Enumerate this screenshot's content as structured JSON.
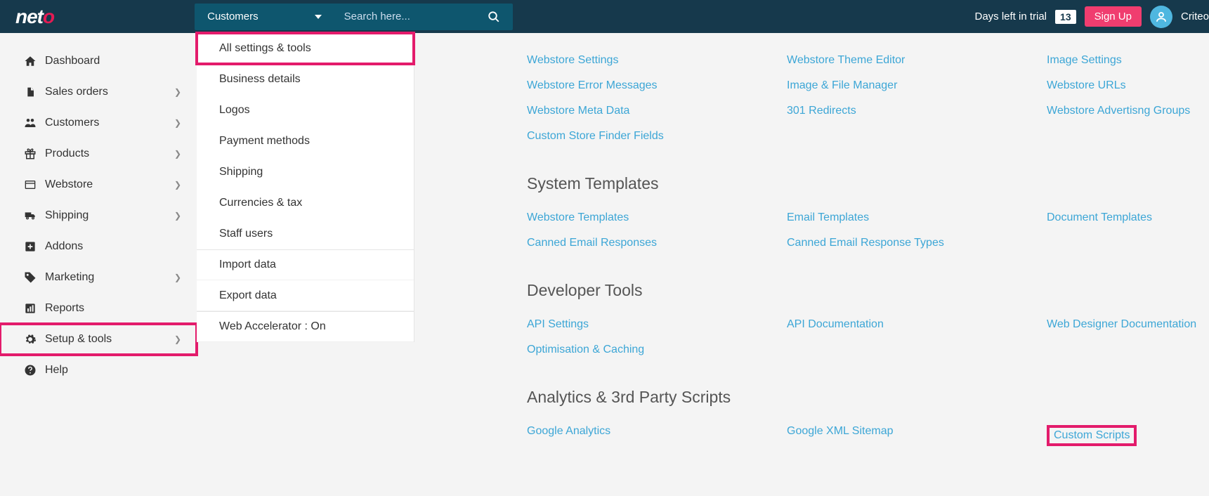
{
  "header": {
    "logo_text": "neto",
    "search_dropdown": "Customers",
    "search_placeholder": "Search here...",
    "trial_label": "Days left in trial",
    "trial_days": "13",
    "signup_label": "Sign Up",
    "user_name": "Criteo"
  },
  "sidebar": {
    "items": [
      {
        "label": "Dashboard",
        "icon": "home",
        "expandable": false
      },
      {
        "label": "Sales orders",
        "icon": "file",
        "expandable": true
      },
      {
        "label": "Customers",
        "icon": "users",
        "expandable": true
      },
      {
        "label": "Products",
        "icon": "gift",
        "expandable": true
      },
      {
        "label": "Webstore",
        "icon": "browser",
        "expandable": true
      },
      {
        "label": "Shipping",
        "icon": "truck",
        "expandable": true
      },
      {
        "label": "Addons",
        "icon": "plus-box",
        "expandable": false
      },
      {
        "label": "Marketing",
        "icon": "tag",
        "expandable": true
      },
      {
        "label": "Reports",
        "icon": "chart",
        "expandable": false
      },
      {
        "label": "Setup & tools",
        "icon": "gear",
        "expandable": true,
        "highlight": true
      },
      {
        "label": "Help",
        "icon": "question",
        "expandable": false
      }
    ]
  },
  "submenu": {
    "items": [
      {
        "label": "All settings & tools",
        "highlight": true
      },
      {
        "label": "Business details"
      },
      {
        "label": "Logos"
      },
      {
        "label": "Payment methods"
      },
      {
        "label": "Shipping"
      },
      {
        "label": "Currencies & tax"
      },
      {
        "label": "Staff users"
      },
      {
        "label": "Import data",
        "topborder": true
      },
      {
        "label": "Export data"
      },
      {
        "label": "Web Accelerator : On",
        "topborder": true
      }
    ]
  },
  "content": {
    "sections": [
      {
        "title": "",
        "links": [
          [
            "Webstore Settings",
            "Webstore Theme Editor",
            "Image Settings"
          ],
          [
            "Webstore Error Messages",
            "Image & File Manager",
            "Webstore URLs"
          ],
          [
            "Webstore Meta Data",
            "301 Redirects",
            "Webstore Advertisng Groups"
          ],
          [
            "Custom Store Finder Fields",
            "",
            ""
          ]
        ]
      },
      {
        "title": "System Templates",
        "links": [
          [
            "Webstore Templates",
            "Email Templates",
            "Document Templates"
          ],
          [
            "Canned Email Responses",
            "Canned Email Response Types",
            ""
          ]
        ]
      },
      {
        "title": "Developer Tools",
        "links": [
          [
            "API Settings",
            "API Documentation",
            "Web Designer Documentation"
          ],
          [
            "Optimisation & Caching",
            "",
            ""
          ]
        ]
      },
      {
        "title": "Analytics & 3rd Party Scripts",
        "links": [
          [
            "Google Analytics",
            "Google XML Sitemap",
            "Custom Scripts"
          ]
        ],
        "highlight_last": true
      }
    ]
  }
}
